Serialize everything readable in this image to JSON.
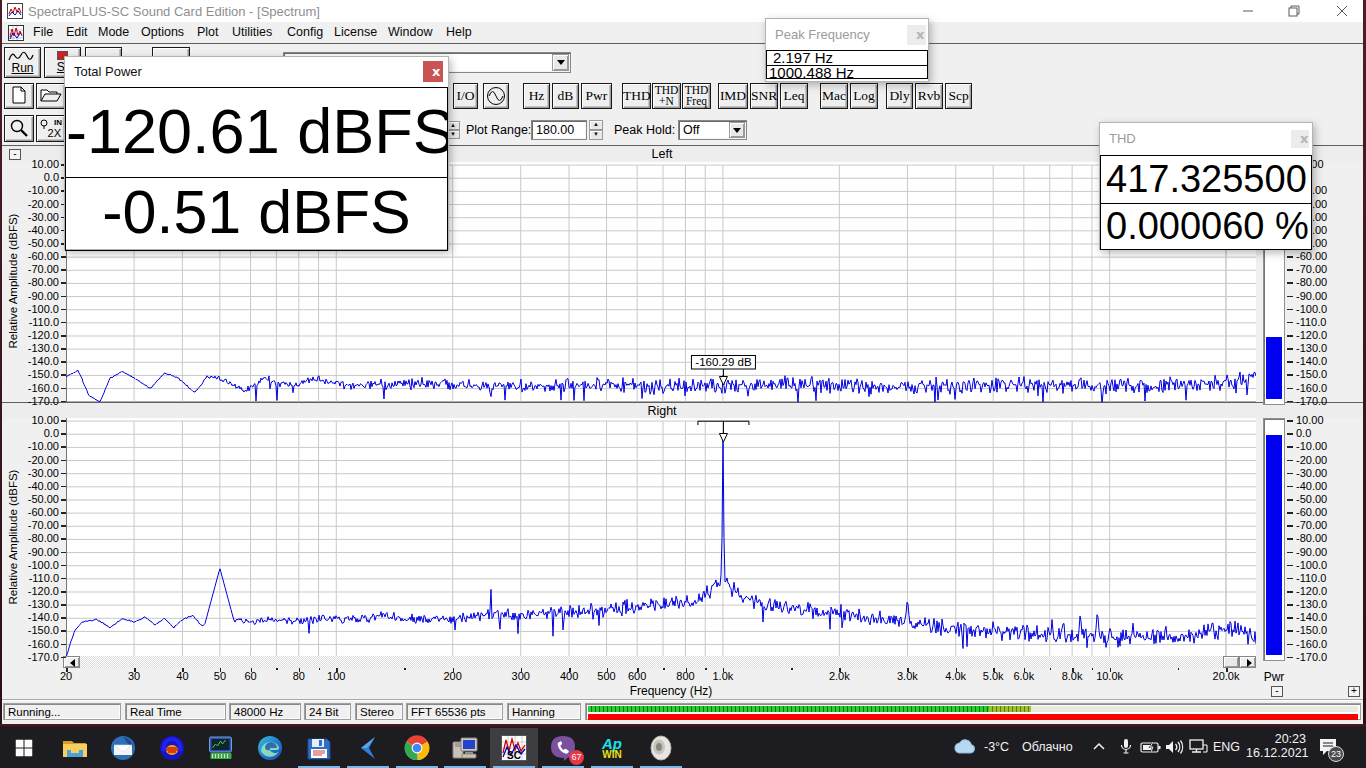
{
  "window": {
    "title": "SpectraPLUS-SC Sound Card Edition - [Spectrum]",
    "controls": [
      "minimize",
      "restore",
      "close"
    ]
  },
  "menu": {
    "items": [
      "File",
      "Edit",
      "Mode",
      "Options",
      "Plot",
      "Utilities",
      "Config",
      "License",
      "Window",
      "Help"
    ]
  },
  "toolbar": {
    "run_label": "Run",
    "stop_label": "St",
    "buttons": {
      "io": "I/O",
      "hz": "Hz",
      "db": "dB",
      "pwr": "Pwr",
      "thd": "THD",
      "thdn1": "THD",
      "thdn2": "+N",
      "thdf1": "THD",
      "thdf2": "Freq",
      "imd": "IMD",
      "snr": "SNR",
      "leq": "Leq",
      "mac": "Mac",
      "log": "Log",
      "dly": "Dly",
      "rvb": "Rvb",
      "scp": "Scp"
    },
    "in2x_top": "IN",
    "in2x_bottom": "2X",
    "plot_range_label": "Plot Range:",
    "plot_range_value": "180.00",
    "peak_hold_label": "Peak Hold:",
    "peak_hold_value": "Off"
  },
  "float_windows": {
    "total_power": {
      "title": "Total Power",
      "close": "x",
      "values": [
        "-120.61 dBFS",
        "-0.51 dBFS"
      ],
      "close_color": "#c85553"
    },
    "peak_frequency": {
      "title": "Peak Frequency",
      "close": "x",
      "values": [
        "2.197 Hz",
        "1000.488 Hz"
      ]
    },
    "thd": {
      "title": "THD",
      "close": "x",
      "values": [
        "417.325500",
        "0.000060 %"
      ]
    }
  },
  "chart_data": [
    {
      "id": "left",
      "type": "line",
      "title": "Left",
      "xscale": "log",
      "xmin": 20,
      "xmax": 23900,
      "ymin": -170,
      "ymax": 10,
      "ylabel": "Relative Amplitude (dBFS)",
      "xlabel": "Frequency (Hz)",
      "trace_color": "#0000e0",
      "grid": true,
      "power_bar_db": -120.61,
      "marker": {
        "f": 1000,
        "label": "-160.29 dB"
      },
      "noise_seed": 1337,
      "envelope": [
        [
          20,
          -151
        ],
        [
          21.5,
          -146
        ],
        [
          23,
          -166
        ],
        [
          24.5,
          -170
        ],
        [
          26,
          -152
        ],
        [
          28,
          -147
        ],
        [
          30,
          -152
        ],
        [
          33,
          -160
        ],
        [
          36,
          -148
        ],
        [
          39,
          -152
        ],
        [
          43,
          -163
        ],
        [
          47,
          -150
        ],
        [
          52,
          -155
        ],
        [
          58,
          -162
        ],
        [
          65,
          -152
        ],
        [
          75,
          -158
        ],
        [
          90,
          -153
        ],
        [
          110,
          -158
        ],
        [
          150,
          -155
        ],
        [
          220,
          -158
        ],
        [
          400,
          -157
        ],
        [
          800,
          -158
        ],
        [
          1500,
          -157
        ],
        [
          3000,
          -158
        ],
        [
          6000,
          -157
        ],
        [
          12000,
          -158
        ],
        [
          20000,
          -156
        ],
        [
          23900,
          -152
        ]
      ],
      "peaks": [
        {
          "f": 1000,
          "v": -150,
          "w": 0.0015
        },
        {
          "f": 23000,
          "v": -144,
          "w": 0.003
        }
      ]
    },
    {
      "id": "right",
      "type": "line",
      "title": "Right",
      "xscale": "log",
      "xmin": 20,
      "xmax": 23900,
      "ymin": -170,
      "ymax": 10,
      "ylabel": "Relative Amplitude (dBFS)",
      "xlabel": "Frequency (Hz)",
      "trace_color": "#0000e0",
      "grid": true,
      "power_bar_db": -0.51,
      "marker": {
        "f": 1000,
        "label": ""
      },
      "noise_seed": 4242,
      "envelope": [
        [
          20,
          -170
        ],
        [
          20.5,
          -160
        ],
        [
          21,
          -150
        ],
        [
          22,
          -143
        ],
        [
          24,
          -141
        ],
        [
          26,
          -147
        ],
        [
          28,
          -140
        ],
        [
          30,
          -143
        ],
        [
          32,
          -139
        ],
        [
          34,
          -145
        ],
        [
          36,
          -140
        ],
        [
          38,
          -147
        ],
        [
          40,
          -141
        ],
        [
          42.5,
          -138
        ],
        [
          45,
          -146
        ],
        [
          48,
          -141
        ],
        [
          55,
          -141
        ],
        [
          60,
          -143
        ],
        [
          70,
          -141
        ],
        [
          80,
          -142
        ],
        [
          95,
          -140
        ],
        [
          110,
          -141
        ],
        [
          130,
          -139
        ],
        [
          160,
          -141
        ],
        [
          200,
          -140
        ],
        [
          250,
          -137
        ],
        [
          320,
          -137
        ],
        [
          400,
          -135
        ],
        [
          500,
          -133
        ],
        [
          620,
          -131
        ],
        [
          700,
          -130
        ],
        [
          800,
          -128
        ],
        [
          860,
          -125
        ],
        [
          920,
          -120
        ],
        [
          960,
          -115
        ],
        [
          985,
          -112
        ],
        [
          1000,
          -111
        ],
        [
          1015,
          -112
        ],
        [
          1040,
          -115
        ],
        [
          1080,
          -120
        ],
        [
          1150,
          -125
        ],
        [
          1250,
          -128
        ],
        [
          1400,
          -131
        ],
        [
          1700,
          -134
        ],
        [
          2000,
          -136
        ],
        [
          2400,
          -139
        ],
        [
          2800,
          -142
        ],
        [
          3200,
          -144
        ],
        [
          3600,
          -146
        ],
        [
          4000,
          -148
        ],
        [
          5000,
          -150
        ],
        [
          6500,
          -152
        ],
        [
          8000,
          -153
        ],
        [
          10000,
          -154
        ],
        [
          13000,
          -154
        ],
        [
          16000,
          -153
        ],
        [
          19000,
          -150
        ],
        [
          21000,
          -148
        ],
        [
          23000,
          -152
        ],
        [
          23900,
          -155
        ]
      ],
      "peaks": [
        {
          "f": 50,
          "v": -102,
          "w": 0.011
        },
        {
          "f": 1000,
          "v": -0.6,
          "w": 0.0015
        },
        {
          "f": 252,
          "v": -118,
          "w": 0.0015
        },
        {
          "f": 2000,
          "v": -135,
          "w": 0.004
        },
        {
          "f": 3000,
          "v": -124,
          "w": 0.0035
        },
        {
          "f": 5000,
          "v": -141,
          "w": 0.004
        },
        {
          "f": 6000,
          "v": -145,
          "w": 0.003
        },
        {
          "f": 7100,
          "v": -140,
          "w": 0.003
        },
        {
          "f": 7600,
          "v": -139,
          "w": 0.003
        },
        {
          "f": 8400,
          "v": -135,
          "w": 0.003
        },
        {
          "f": 9300,
          "v": -133,
          "w": 0.003
        },
        {
          "f": 11500,
          "v": -143,
          "w": 0.003
        },
        {
          "f": 14000,
          "v": -145,
          "w": 0.003
        },
        {
          "f": 18500,
          "v": -143,
          "w": 0.004
        },
        {
          "f": 20500,
          "v": -141,
          "w": 0.003
        }
      ]
    }
  ],
  "axes": {
    "y_tick_labels": [
      "10.00",
      "0.0",
      "-10.00",
      "-20.00",
      "-30.00",
      "-40.00",
      "-50.00",
      "-60.00",
      "-70.00",
      "-80.00",
      "-90.00",
      "-100.0",
      "-110.0",
      "-120.0",
      "-130.0",
      "-140.0",
      "-150.0",
      "-160.0",
      "-170.0"
    ],
    "x_major_ticks": [
      {
        "f": 20,
        "label": "20"
      },
      {
        "f": 30,
        "label": "30"
      },
      {
        "f": 40,
        "label": "40"
      },
      {
        "f": 50,
        "label": "50"
      },
      {
        "f": 60,
        "label": "60"
      },
      {
        "f": 80,
        "label": "80"
      },
      {
        "f": 100,
        "label": "100"
      },
      {
        "f": 200,
        "label": "200"
      },
      {
        "f": 300,
        "label": "300"
      },
      {
        "f": 400,
        "label": "400"
      },
      {
        "f": 500,
        "label": "500"
      },
      {
        "f": 600,
        "label": "600"
      },
      {
        "f": 800,
        "label": "800"
      },
      {
        "f": 1000,
        "label": "1.0k"
      },
      {
        "f": 2000,
        "label": "2.0k"
      },
      {
        "f": 3000,
        "label": "3.0k"
      },
      {
        "f": 4000,
        "label": "4.0k"
      },
      {
        "f": 5000,
        "label": "5.0k"
      },
      {
        "f": 6000,
        "label": "6.0k"
      },
      {
        "f": 8000,
        "label": "8.0k"
      },
      {
        "f": 10000,
        "label": "10.0k"
      },
      {
        "f": 20000,
        "label": "20.0k"
      }
    ],
    "x_minor_ticks": [
      70,
      90,
      150,
      700,
      900,
      1500,
      7000,
      9000,
      15000
    ],
    "pwr_label": "Pwr",
    "zoom_minus": "-",
    "zoom_plus": "+",
    "collapse_box": "-"
  },
  "statusbar": {
    "items": [
      "Running...",
      "Real Time",
      "48000 Hz",
      "24 Bit",
      "Stereo",
      "FFT 65536 pts",
      "Hanning"
    ],
    "meter": {
      "green_pct": 57.5,
      "red_pct": 100
    }
  },
  "taskbar": {
    "apps": [
      {
        "name": "start",
        "running": false
      },
      {
        "name": "file-explorer",
        "running": false
      },
      {
        "name": "thunderbird",
        "running": false
      },
      {
        "name": "audacity",
        "running": false
      },
      {
        "name": "hw-monitor",
        "running": false
      },
      {
        "name": "edge",
        "running": false
      },
      {
        "name": "floppy-tool",
        "running": true
      },
      {
        "name": "chevron-app",
        "running": true
      },
      {
        "name": "chrome",
        "running": true
      },
      {
        "name": "system-info",
        "running": true
      },
      {
        "name": "spectraplus",
        "running": true,
        "active": true
      },
      {
        "name": "viber",
        "running": true,
        "badge": "67"
      },
      {
        "name": "apwin",
        "running": true,
        "text_top": "Ap",
        "text_bottom": "WIN"
      },
      {
        "name": "speaker-app",
        "running": true
      }
    ],
    "tray": {
      "temperature": "-3°C",
      "condition": "Облачно",
      "language": "ENG",
      "time": "20:23",
      "date": "16.12.2021",
      "notification_badge": "23"
    }
  }
}
